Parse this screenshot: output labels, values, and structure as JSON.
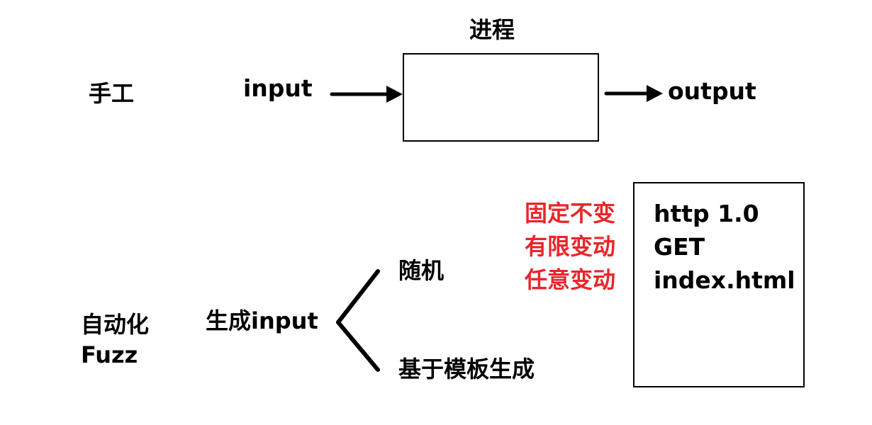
{
  "top": {
    "process_label": "进程",
    "manual_label": "手工",
    "input_label": "input",
    "output_label": "output"
  },
  "bottom": {
    "automation_label": "自动化",
    "fuzz_label": "Fuzz",
    "generate_input_label": "生成input",
    "random_label": "随机",
    "template_label": "基于模板生成",
    "categories": [
      "固定不变",
      "有限变动",
      "任意变动"
    ],
    "request_lines": [
      "http 1.0",
      "GET",
      "index.html"
    ]
  },
  "colors": {
    "stroke": "#000000",
    "highlight": "#e8262a"
  }
}
